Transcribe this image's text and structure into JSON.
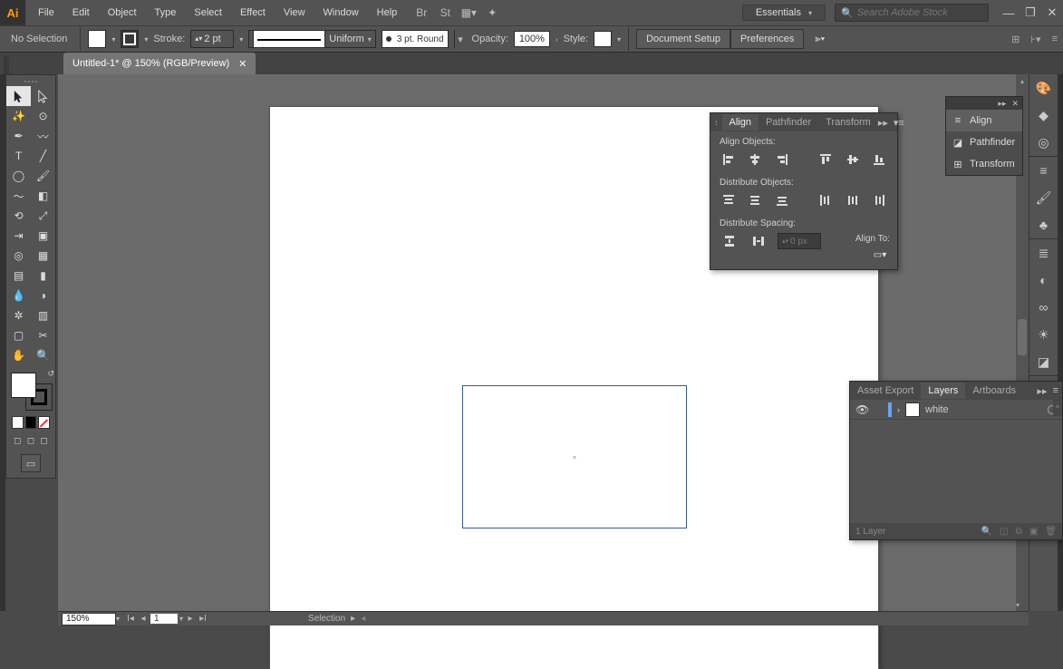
{
  "menu": {
    "items": [
      "File",
      "Edit",
      "Object",
      "Type",
      "Select",
      "Effect",
      "View",
      "Window",
      "Help"
    ]
  },
  "workspace": {
    "label": "Essentials"
  },
  "search": {
    "placeholder": "Search Adobe Stock"
  },
  "control": {
    "noselection": "No Selection",
    "stroke_label": "Stroke:",
    "stroke_weight": "2 pt",
    "stroke_uniform": "Uniform",
    "profile": "3 pt. Round",
    "opacity_label": "Opacity:",
    "opacity_value": "100%",
    "style_label": "Style:",
    "doc_setup": "Document Setup",
    "preferences": "Preferences"
  },
  "doc_tab": {
    "title": "Untitled-1* @ 150% (RGB/Preview)"
  },
  "align_panel": {
    "tab_align": "Align",
    "tab_pathfinder": "Pathfinder",
    "tab_transform": "Transform",
    "align_objects": "Align Objects:",
    "distribute_objects": "Distribute Objects:",
    "distribute_spacing": "Distribute Spacing:",
    "align_to": "Align To:",
    "spacing_value": "0 px"
  },
  "side_list": {
    "align": "Align",
    "pathfinder": "Pathfinder",
    "transform": "Transform"
  },
  "layers": {
    "tab_export": "Asset Export",
    "tab_layers": "Layers",
    "tab_artboards": "Artboards",
    "row1": "white",
    "footer": "1 Layer"
  },
  "status": {
    "zoom": "150%",
    "page": "1",
    "tool": "Selection"
  }
}
